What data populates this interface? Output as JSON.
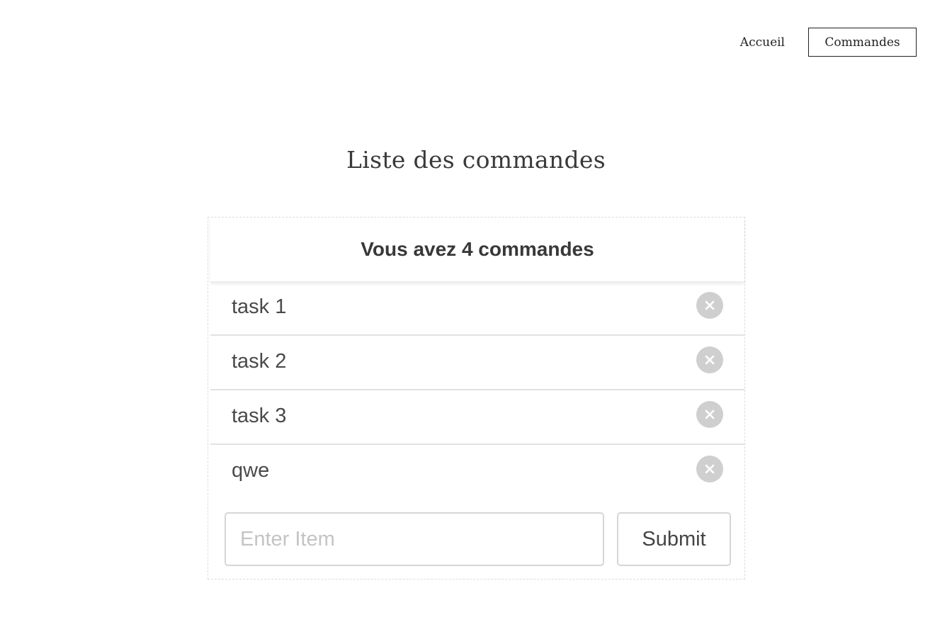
{
  "nav": {
    "items": [
      {
        "label": "Accueil",
        "active": false
      },
      {
        "label": "Commandes",
        "active": true
      }
    ]
  },
  "page": {
    "title": "Liste des commandes"
  },
  "card": {
    "header": "Vous avez 4 commandes",
    "items": [
      {
        "label": "task 1",
        "remove_icon": "close-circle-icon"
      },
      {
        "label": "task 2",
        "remove_icon": "close-circle-icon"
      },
      {
        "label": "task 3",
        "remove_icon": "close-circle-icon"
      },
      {
        "label": "qwe",
        "remove_icon": "close-circle-icon"
      }
    ],
    "form": {
      "input_value": "",
      "input_placeholder": "Enter Item",
      "submit_label": "Submit"
    }
  },
  "colors": {
    "text": "#222222",
    "remove_icon_bg": "#cfcfcf",
    "border": "#d6d6d6"
  }
}
